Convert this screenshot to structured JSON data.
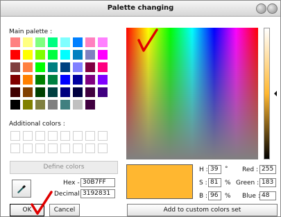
{
  "window": {
    "title": "Palette changing"
  },
  "main_palette": {
    "label": "Main palette :",
    "colors": [
      "#ff8080",
      "#ffff80",
      "#80ff80",
      "#00ff80",
      "#80ffff",
      "#0080ff",
      "#ff80c0",
      "#ff80ff",
      "#ff0000",
      "#ffff00",
      "#80ff00",
      "#00ff40",
      "#00ffff",
      "#0080c0",
      "#8080c0",
      "#ff00ff",
      "#804040",
      "#ff8040",
      "#00ff00",
      "#008080",
      "#004080",
      "#8080ff",
      "#800040",
      "#ff0080",
      "#800000",
      "#ff8000",
      "#008000",
      "#008040",
      "#0000ff",
      "#0000a0",
      "#800080",
      "#8000ff",
      "#400000",
      "#804000",
      "#004000",
      "#004040",
      "#000080",
      "#000040",
      "#400040",
      "#400080",
      "#000000",
      "#808000",
      "#808040",
      "#808080",
      "#408080",
      "#c0c0c0",
      "#400040",
      "#ffffff"
    ]
  },
  "additional": {
    "label": "Additional colors :",
    "colors": [
      "#ffffff",
      "#ffffff",
      "#ffffff",
      "#ffffff",
      "#ffffff",
      "#ffffff",
      "#ffffff",
      "#ffffff",
      "#ffffff",
      "#ffffff",
      "#ffffff",
      "#ffffff",
      "#ffffff",
      "#ffffff",
      "#ffffff",
      "#ffffff"
    ]
  },
  "define_button": "Define colors",
  "eyedropper_icon": "eyedropper-icon",
  "hex": {
    "label": "Hex -",
    "value": "30B7FF"
  },
  "decimal": {
    "label": "Decimal -",
    "value": "3192831"
  },
  "ok_button": "OK",
  "cancel_button": "Cancel",
  "hsb": {
    "h_label": "H :",
    "h_value": "39",
    "h_unit": "°",
    "s_label": "S :",
    "s_value": "81",
    "s_unit": "%",
    "b_label": "B :",
    "b_value": "96",
    "b_unit": "%"
  },
  "rgb": {
    "r_label": "Red :",
    "r_value": "255",
    "g_label": "Green :",
    "g_value": "183",
    "b_label": "Blue :",
    "b_value": "48"
  },
  "add_custom_button": "Add to custom colors set",
  "selected_color": "#ffb730",
  "lum_marker_fraction": 0.5,
  "checkmark_color": "#e00000"
}
